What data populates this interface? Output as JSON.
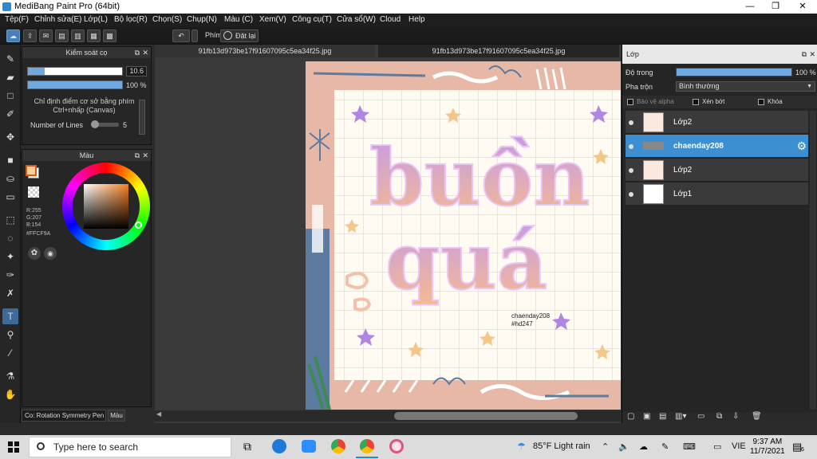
{
  "window": {
    "title": "MediBang Paint Pro (64bit)",
    "btn_min": "—",
    "btn_max": "❐",
    "btn_close": "✕"
  },
  "menu": [
    "Tệp(F)",
    "Chỉnh sửa(E)",
    "Lớp(L)",
    "Bộ lọc(R)",
    "Chọn(S)",
    "Chụp(N)",
    "Màu (C)",
    "Xem(V)",
    "Công cụ(T)",
    "Cửa sổ(W)",
    "Cloud",
    "Help"
  ],
  "toolbar": {
    "phim_label": "Phím",
    "reset_label": "Đặt lại"
  },
  "brush_panel": {
    "title": "Kiểm soát cọ",
    "size_value": "10.6",
    "opacity_value": "100 %",
    "opacity_fraction": 1.0,
    "size_fraction": 0.18,
    "hint_line1": "Chỉ định điểm cơ sở bằng phím",
    "hint_line2": "Ctrl+nhấp (Canvas)",
    "lines_label": "Number of Lines",
    "lines_value": "5"
  },
  "color_panel": {
    "title": "Màu",
    "r": "R:255",
    "g": "G:207",
    "b": "B:154",
    "hex": "#FFCF9A",
    "fg_color": "#FFCF9A",
    "bg_color": "#FFFFFF"
  },
  "bottom_tabs": {
    "tab1": "Co: Rotation Symmetry Pen",
    "tab2": "Màu"
  },
  "tabs": [
    "91fb13d973be17f91607095c5ea34f25.jpg",
    "91fb13d973be17f91607095c5ea34f25.jpg"
  ],
  "artwork": {
    "word1": "buồn",
    "word2": "quá",
    "signature_line1": "chaenday208",
    "signature_line2": "#hd247"
  },
  "layer_panel": {
    "title": "Lớp",
    "opacity_label": "Độ trong",
    "opacity_value": "100 %",
    "blend_label": "Pha trộn",
    "blend_value": "Bình thường",
    "protect_alpha": "Bảo vệ alpha",
    "clipping": "Xén bớt",
    "lock": "Khóa",
    "layers": [
      {
        "name": "Lớp2",
        "selected": false
      },
      {
        "name": "chaenday208",
        "selected": true
      },
      {
        "name": "Lớp2",
        "selected": false
      },
      {
        "name": "Lớp1",
        "selected": false
      }
    ]
  },
  "taskbar": {
    "search_placeholder": "Type here to search",
    "weather": "85°F  Light rain",
    "lang": "VIE",
    "time": "9:37 AM",
    "date": "11/7/2021",
    "notif_count": "6"
  },
  "colors": {
    "accent": "#3c8fd0",
    "panel_bg": "#262626",
    "canvas_bg": "#3a3a3a"
  }
}
